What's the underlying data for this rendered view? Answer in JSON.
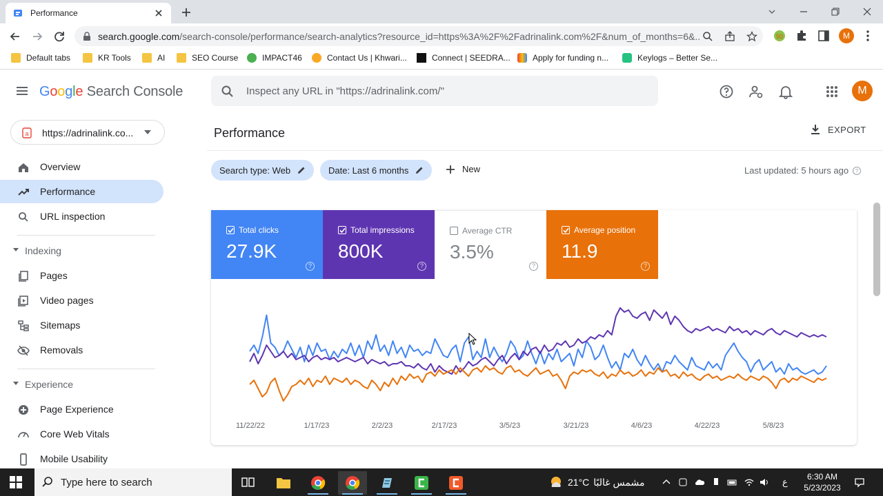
{
  "browser": {
    "tab_title": "Performance",
    "url_domain": "search.google.com",
    "url_path": "/search-console/performance/search-analytics?resource_id=https%3A%2F%2Fadrinalink.com%2F&num_of_months=6&...",
    "bookmarks": [
      {
        "label": "Default tabs",
        "icon": "folder-icon"
      },
      {
        "label": "KR Tools",
        "icon": "folder-icon"
      },
      {
        "label": "AI",
        "icon": "folder-icon"
      },
      {
        "label": "SEO Course",
        "icon": "folder-icon"
      },
      {
        "label": "IMPACT46",
        "icon": "impact-icon"
      },
      {
        "label": "Contact Us | Khwari...",
        "icon": "khwarizmi-icon"
      },
      {
        "label": "Connect | SEEDRA...",
        "icon": "seedra-icon"
      },
      {
        "label": "Apply for funding n...",
        "icon": "funding-icon"
      },
      {
        "label": "Keylogs – Better Se...",
        "icon": "keylogs-icon"
      }
    ]
  },
  "header": {
    "logo_google": [
      "G",
      "o",
      "o",
      "g",
      "l",
      "e"
    ],
    "logo_product": "Search Console",
    "search_placeholder": "Inspect any URL in \"https://adrinalink.com/\"",
    "avatar_letter": "M"
  },
  "sidebar": {
    "property": "https://adrinalink.co...",
    "items": [
      {
        "label": "Overview",
        "icon": "home-icon"
      },
      {
        "label": "Performance",
        "icon": "trending-icon",
        "active": true
      },
      {
        "label": "URL inspection",
        "icon": "search-icon"
      }
    ],
    "sections": [
      {
        "label": "Indexing",
        "items": [
          {
            "label": "Pages",
            "icon": "pages-icon"
          },
          {
            "label": "Video pages",
            "icon": "video-pages-icon"
          },
          {
            "label": "Sitemaps",
            "icon": "sitemaps-icon"
          },
          {
            "label": "Removals",
            "icon": "removals-icon"
          }
        ]
      },
      {
        "label": "Experience",
        "items": [
          {
            "label": "Page Experience",
            "icon": "page-experience-icon"
          },
          {
            "label": "Core Web Vitals",
            "icon": "gauge-icon"
          },
          {
            "label": "Mobile Usability",
            "icon": "phone-icon"
          }
        ]
      }
    ]
  },
  "main": {
    "title": "Performance",
    "export_label": "EXPORT",
    "filters": [
      {
        "label": "Search type: Web"
      },
      {
        "label": "Date: Last 6 months"
      }
    ],
    "new_label": "New",
    "last_updated": "Last updated: 5 hours ago"
  },
  "metrics": [
    {
      "label": "Total clicks",
      "value": "27.9K",
      "checked": true,
      "color": "#4285f4"
    },
    {
      "label": "Total impressions",
      "value": "800K",
      "checked": true,
      "color": "#5e35b1"
    },
    {
      "label": "Average CTR",
      "value": "3.5%",
      "checked": false,
      "color": "#00897b"
    },
    {
      "label": "Average position",
      "value": "11.9",
      "checked": true,
      "color": "#e8710a"
    }
  ],
  "chart_data": {
    "type": "line",
    "x_tick_labels": [
      "11/22/22",
      "1/17/23",
      "2/2/23",
      "2/17/23",
      "3/5/23",
      "3/21/23",
      "4/6/23",
      "4/22/23",
      "5/8/23"
    ],
    "y_axis_labels_visible": false,
    "grid": false,
    "series": [
      {
        "name": "Total clicks",
        "color": "#4285f4",
        "values": [
          50,
          56,
          48,
          64,
          85,
          58,
          54,
          46,
          50,
          60,
          52,
          44,
          54,
          40,
          56,
          46,
          58,
          50,
          52,
          42,
          50,
          44,
          52,
          48,
          58,
          46,
          56,
          44,
          60,
          52,
          66,
          50,
          56,
          46,
          60,
          48,
          54,
          44,
          56,
          50,
          52,
          46,
          50,
          48,
          62,
          54,
          46,
          44,
          52,
          56,
          40,
          58,
          64,
          42,
          50,
          44,
          62,
          44,
          54,
          46,
          40,
          48,
          60,
          54,
          42,
          46,
          60,
          48,
          38,
          50,
          38,
          48,
          42,
          52,
          40,
          44,
          48,
          36,
          52,
          44,
          60,
          54,
          42,
          46,
          56,
          44,
          34,
          40,
          32,
          48,
          44,
          52,
          42,
          36,
          46,
          38,
          32,
          38,
          30,
          40,
          38,
          46,
          40,
          36,
          32,
          44,
          36,
          34,
          32,
          40,
          34,
          38,
          32,
          46,
          52,
          58,
          50,
          44,
          40,
          30,
          38,
          42,
          32,
          36,
          40,
          30,
          34,
          28,
          38,
          32,
          34,
          30,
          28,
          30,
          32,
          28,
          30,
          36
        ]
      },
      {
        "name": "Total impressions",
        "color": "#5e35b1",
        "values": [
          40,
          48,
          38,
          46,
          56,
          50,
          44,
          46,
          50,
          44,
          48,
          42,
          44,
          46,
          40,
          44,
          46,
          42,
          44,
          42,
          44,
          40,
          42,
          44,
          42,
          40,
          42,
          44,
          38,
          42,
          40,
          38,
          40,
          36,
          38,
          38,
          40,
          36,
          36,
          34,
          38,
          34,
          32,
          38,
          30,
          36,
          32,
          30,
          28,
          36,
          30,
          34,
          40,
          36,
          38,
          42,
          44,
          40,
          36,
          42,
          46,
          38,
          44,
          48,
          42,
          50,
          46,
          52,
          54,
          48,
          56,
          50,
          52,
          58,
          56,
          60,
          54,
          56,
          62,
          58,
          60,
          64,
          62,
          66,
          64,
          70,
          66,
          84,
          92,
          88,
          90,
          84,
          82,
          86,
          88,
          80,
          90,
          86,
          82,
          88,
          76,
          84,
          80,
          74,
          70,
          68,
          72,
          70,
          72,
          74,
          70,
          72,
          70,
          68,
          74,
          70,
          72,
          68,
          70,
          66,
          70,
          68,
          66,
          70,
          72,
          68,
          66,
          70,
          68,
          66,
          64,
          68,
          66,
          64,
          66,
          64,
          66,
          64
        ]
      },
      {
        "name": "Average position",
        "color": "#e8710a",
        "values": [
          18,
          22,
          14,
          6,
          10,
          20,
          24,
          12,
          2,
          8,
          16,
          18,
          22,
          18,
          24,
          16,
          22,
          20,
          26,
          18,
          24,
          22,
          20,
          24,
          18,
          22,
          20,
          16,
          14,
          22,
          18,
          12,
          20,
          16,
          24,
          18,
          26,
          22,
          28,
          24,
          26,
          20,
          28,
          30,
          26,
          32,
          28,
          30,
          32,
          28,
          34,
          30,
          26,
          32,
          34,
          30,
          36,
          32,
          34,
          30,
          28,
          34,
          36,
          30,
          32,
          28,
          26,
          30,
          34,
          28,
          30,
          32,
          26,
          28,
          22,
          14,
          26,
          30,
          28,
          32,
          30,
          32,
          28,
          26,
          30,
          24,
          28,
          26,
          32,
          28,
          30,
          26,
          28,
          32,
          26,
          30,
          28,
          34,
          30,
          32,
          26,
          28,
          24,
          30,
          26,
          28,
          24,
          22,
          26,
          28,
          24,
          26,
          22,
          24,
          26,
          24,
          28,
          24,
          22,
          26,
          24,
          22,
          26,
          24,
          20,
          14,
          22,
          24,
          20,
          24,
          22,
          26,
          24,
          22,
          20,
          24,
          22,
          24
        ]
      }
    ]
  },
  "taskbar": {
    "search_placeholder": "Type here to search",
    "weather_temp": "21°C",
    "weather_text": "مشمس غالبًا",
    "lang": "ع",
    "time": "6:30 AM",
    "date": "5/23/2023"
  }
}
